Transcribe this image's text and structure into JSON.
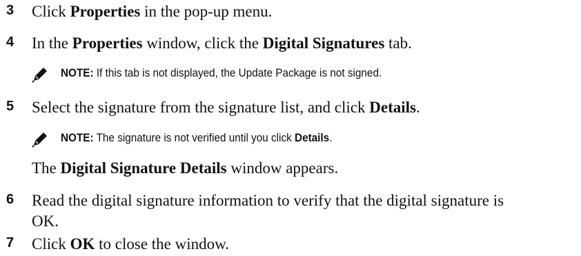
{
  "steps": [
    {
      "number": "3",
      "parts": [
        "Click ",
        "Properties",
        " in the pop-up menu."
      ]
    },
    {
      "number": "4",
      "parts": [
        "In the ",
        "Properties",
        " window, click the ",
        "Digital Signatures",
        " tab."
      ]
    },
    {
      "number": "5",
      "parts": [
        "Select the signature from the signature list, and click ",
        "Details",
        "."
      ]
    },
    {
      "number": "6",
      "line1": "Read the digital signature information to verify that the digital signature is",
      "line2": "OK."
    },
    {
      "number": "7",
      "parts": [
        "Click ",
        "OK",
        " to close the window."
      ]
    }
  ],
  "notes": [
    {
      "label": "NOTE:",
      "text": " If this tab is not displayed, the Update Package is not signed."
    },
    {
      "label": "NOTE:",
      "text": " The signature is not verified until you click ",
      "bold_end": "Details",
      "end": "."
    }
  ],
  "after_note": {
    "bold": "Digital Signature Details",
    "text": " window appears.",
    "prefix": "The "
  },
  "icon": "note-pencil-icon"
}
